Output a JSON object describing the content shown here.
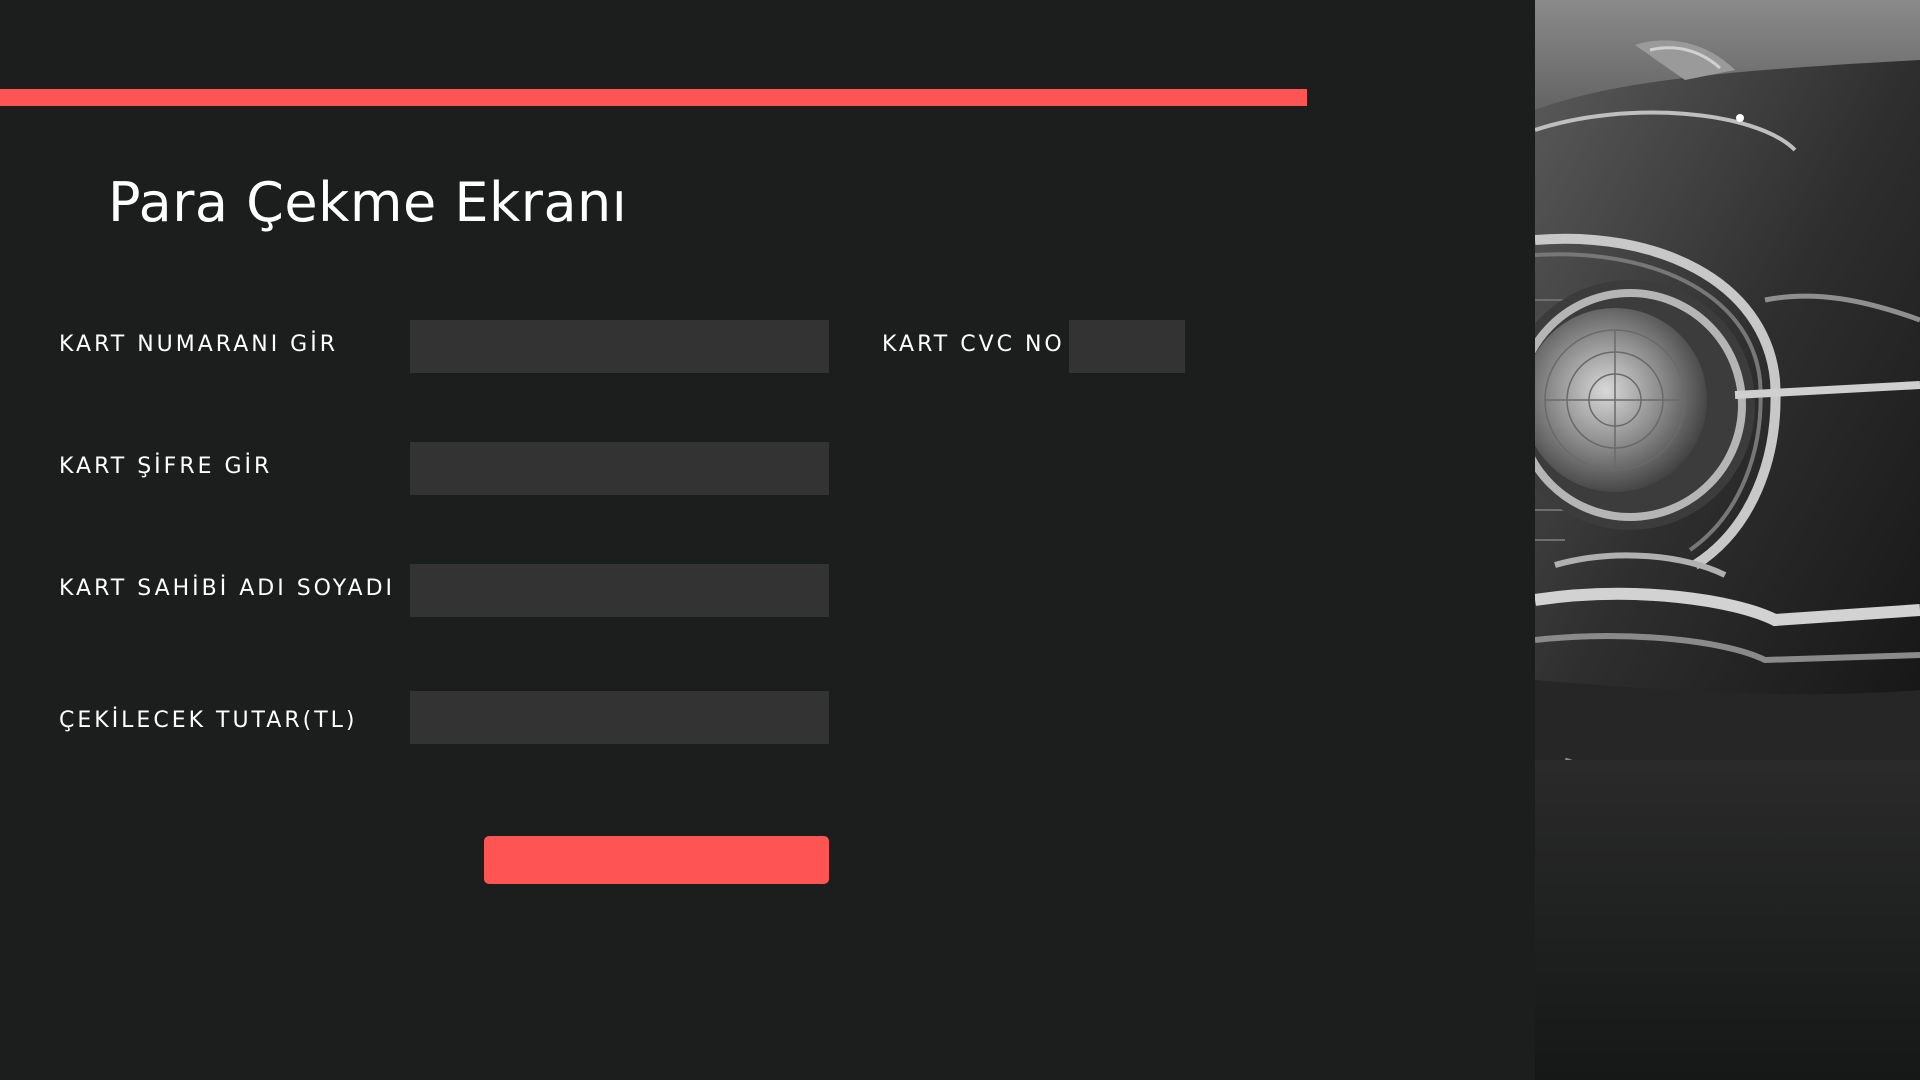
{
  "header": {
    "title": "Para Çekme Ekranı",
    "accent_color": "#ff5454"
  },
  "form": {
    "card_number": {
      "label": "KART NUMARANI GİR",
      "value": "",
      "placeholder": ""
    },
    "card_cvc": {
      "label": "KART CVC NO",
      "value": "",
      "placeholder": ""
    },
    "card_password": {
      "label": "KART ŞİFRE GİR",
      "value": "",
      "placeholder": ""
    },
    "card_holder": {
      "label": "KART SAHİBİ ADI SOYADI",
      "value": "",
      "placeholder": ""
    },
    "amount": {
      "label": "ÇEKİLECEK TUTAR(TL)",
      "value": "",
      "placeholder": ""
    },
    "submit_label": ""
  },
  "side_image": {
    "subject": "classic-car-headlight-photo",
    "tone": "grayscale"
  },
  "colors": {
    "background": "#1c1e1e",
    "input_background": "#333333",
    "text": "#ffffff",
    "accent": "#ff5454"
  }
}
